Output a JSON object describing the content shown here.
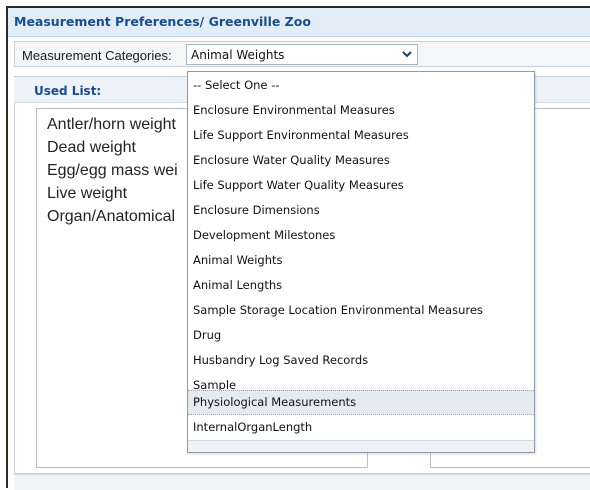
{
  "header": {
    "title": "Measurement Preferences/ Greenville Zoo"
  },
  "category_select": {
    "label": "Measurement Categories:",
    "value": "Animal Weights",
    "arrow_icon": "chevron-down-icon"
  },
  "used_panel": {
    "label": "Used List:",
    "items": [
      "Antler/horn weight",
      "Dead weight",
      "Egg/egg mass wei",
      "Live weight",
      "Organ/Anatomical"
    ]
  },
  "dropdown": {
    "options": [
      "-- Select One --",
      "Enclosure Environmental Measures",
      "Life Support Environmental Measures",
      "Enclosure Water Quality Measures",
      "Life Support Water Quality Measures",
      "Enclosure Dimensions",
      "Development Milestones",
      "Animal Weights",
      "Animal Lengths",
      "Sample Storage Location Environmental Measures",
      "Drug",
      "Husbandry Log Saved Records",
      "Sample",
      "Physiological Measurements",
      "InternalOrganLength"
    ],
    "highlighted_option": "Physiological Measurements",
    "resize_icon": "resize-grip-icon"
  },
  "colors": {
    "title_text": "#1c4d88",
    "header_bg": "#e3edf8",
    "highlight_bg": "#e4ebf3"
  }
}
